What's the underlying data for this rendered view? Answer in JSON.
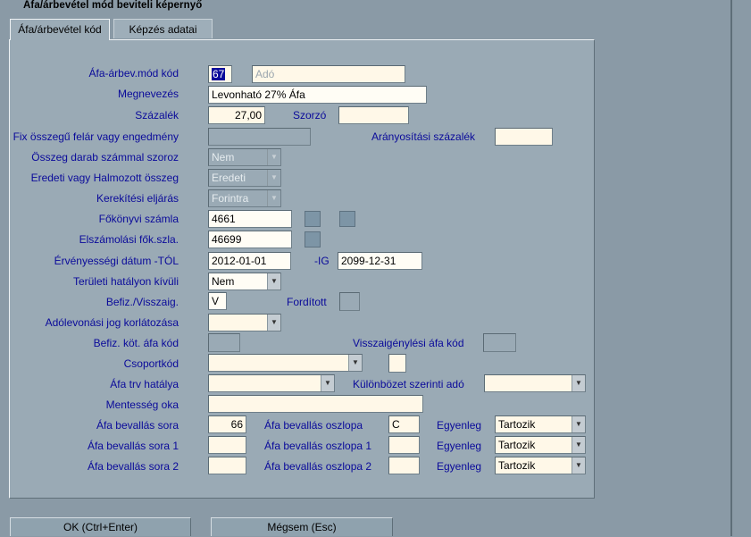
{
  "window": {
    "title": "Áfa/árbevétel mód beviteli képernyő"
  },
  "tabs": [
    {
      "label": "Áfa/árbevétel kód"
    },
    {
      "label": "Képzés adatai"
    }
  ],
  "form": {
    "afa_kod": {
      "label": "Áfa-árbev.mód kód",
      "value": "67",
      "placeholder": "Adó"
    },
    "megnevezes": {
      "label": "Megnevezés",
      "value": "Levonható 27% Áfa"
    },
    "szazalek": {
      "label": "Százalék",
      "value": "27,00"
    },
    "szorzo": {
      "label": "Szorzó",
      "value": ""
    },
    "fix_osszegu": {
      "label": "Fix összegű felár vagy engedmény",
      "value": ""
    },
    "aranyositasi": {
      "label": "Arányosítási százalék",
      "value": ""
    },
    "osszeg_darab": {
      "label": "Összeg darab számmal szoroz",
      "value": "Nem"
    },
    "eredeti_halmozott": {
      "label": "Eredeti vagy Halmozott összeg",
      "value": "Eredeti"
    },
    "kerekitesi": {
      "label": "Kerekítési eljárás",
      "value": "Forintra"
    },
    "fokonyvi": {
      "label": "Főkönyvi számla",
      "value": "4661"
    },
    "elszamolasi": {
      "label": "Elszámolási fők.szla.",
      "value": "46699"
    },
    "ervenyesseg_tol": {
      "label": "Érvényességi dátum -TÓL",
      "value": "2012-01-01"
    },
    "ervenyesseg_ig": {
      "label": "-IG",
      "value": "2099-12-31"
    },
    "teruleti": {
      "label": "Területi hatályon kívüli",
      "value": "Nem"
    },
    "befiz_visszaig": {
      "label": "Befiz./Visszaig.",
      "value": "V"
    },
    "forditott": {
      "label": "Fordított",
      "value": ""
    },
    "adolevonasi": {
      "label": "Adólevonási jog korlátozása",
      "value": ""
    },
    "befiz_kot": {
      "label": "Befiz. köt. áfa kód",
      "value": ""
    },
    "visszaigenylesi": {
      "label": "Visszaigénylési áfa kód",
      "value": ""
    },
    "csoportkod": {
      "label": "Csoportkód",
      "value": ""
    },
    "afa_trv": {
      "label": "Áfa trv hatálya",
      "value": ""
    },
    "kulonbozet": {
      "label": "Különbözet szerinti adó",
      "value": ""
    },
    "mentesseg": {
      "label": "Mentesség oka",
      "value": ""
    },
    "bevallas_rows": [
      {
        "sora_label": "Áfa bevallás sora",
        "sora": "66",
        "oszlop_label": "Áfa bevallás oszlopa",
        "oszlop": "C",
        "egyenleg_label": "Egyenleg",
        "egyenleg": "Tartozik"
      },
      {
        "sora_label": "Áfa bevallás sora 1",
        "sora": "",
        "oszlop_label": "Áfa bevallás oszlopa 1",
        "oszlop": "",
        "egyenleg_label": "Egyenleg",
        "egyenleg": "Tartozik"
      },
      {
        "sora_label": "Áfa bevallás sora 2",
        "sora": "",
        "oszlop_label": "Áfa bevallás oszlopa 2",
        "oszlop": "",
        "egyenleg_label": "Egyenleg",
        "egyenleg": "Tartozik"
      }
    ]
  },
  "buttons": {
    "ok": "OK (Ctrl+Enter)",
    "cancel": "Mégsem (Esc)"
  },
  "colors": {
    "label": "#0a0a9a",
    "panel": "#9aaab5",
    "field": "#fff8e8",
    "highlight": "#0a0a9a"
  }
}
